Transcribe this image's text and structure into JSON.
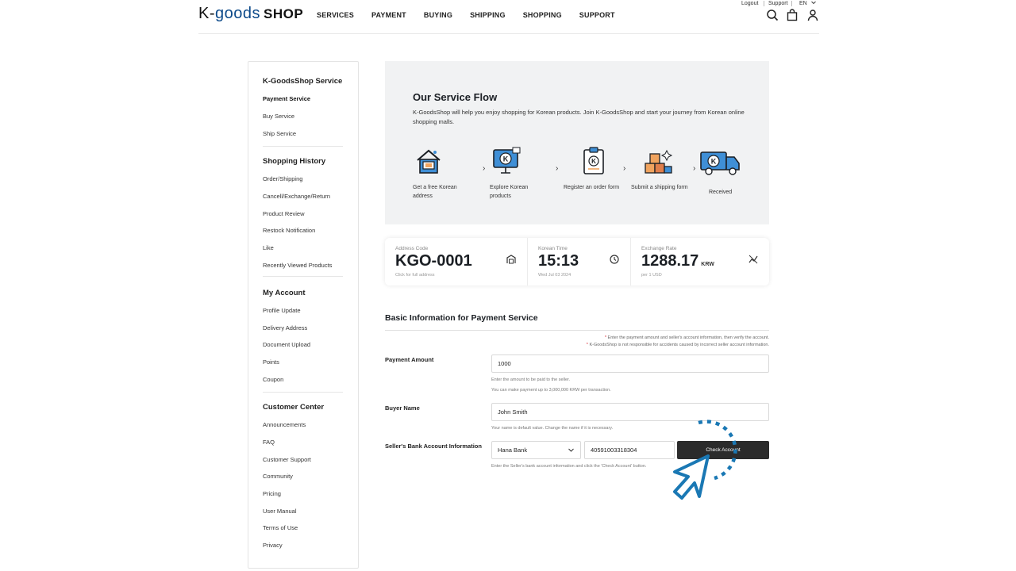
{
  "header": {
    "logo_part1": "K-",
    "logo_part2": "goods",
    "logo_part3": "SHOP",
    "nav": [
      "SERVICES",
      "PAYMENT",
      "BUYING",
      "SHIPPING",
      "SHOPPING",
      "SUPPORT"
    ],
    "util": {
      "logout": "Logout",
      "support": "Support",
      "lang": "EN"
    }
  },
  "sidebar": {
    "groups": [
      {
        "title": "K-GoodsShop Service",
        "items": [
          "Payment Service",
          "Buy Service",
          "Ship Service"
        ]
      },
      {
        "title": "Shopping History",
        "items": [
          "Order/Shipping",
          "Cancell/Exchange/Return",
          "Product Review",
          "Restock Notification",
          "Like",
          "Recently Viewed Products"
        ]
      },
      {
        "title": "My Account",
        "items": [
          "Profile Update",
          "Delivery Address",
          "Document Upload",
          "Points",
          "Coupon"
        ]
      },
      {
        "title": "Customer Center",
        "items": [
          "Announcements",
          "FAQ",
          "Customer Support",
          "Community",
          "Pricing",
          "User Manual",
          "Terms of Use",
          "Privacy"
        ]
      }
    ]
  },
  "flow": {
    "title": "Our Service Flow",
    "description": "K-GoodsShop will help you enjoy shopping for Korean products. Join K-GoodsShop and start your journey from Korean online shopping malls.",
    "steps": [
      {
        "label": "Get a free Korean address",
        "icon": "house-address-icon"
      },
      {
        "label": "Explore Korean products",
        "icon": "monitor-browse-icon"
      },
      {
        "label": "Register an order form",
        "icon": "clipboard-order-icon"
      },
      {
        "label": "Submit a shipping form",
        "icon": "stacked-boxes-icon"
      },
      {
        "label": "Received",
        "icon": "delivery-truck-icon"
      }
    ],
    "arrow": "›"
  },
  "info": {
    "address": {
      "label": "Address Code",
      "value": "KGO-0001",
      "sub": "Click for full address"
    },
    "time": {
      "label": "Korean Time",
      "value": "15:13",
      "sub": "Wed Jul 03 2024"
    },
    "rate": {
      "label": "Exchange Rate",
      "value": "1288.17",
      "unit": "KRW",
      "sub": "per 1 USD"
    }
  },
  "form": {
    "title": "Basic Information for Payment Service",
    "notice1": "Enter the payment amount and seller's account information, then verify the account.",
    "notice2": "K-GoodsShop is not responsible for accidents caused by incorrect seller account information.",
    "notice_star": "*",
    "payment_amount": {
      "label": "Payment Amount",
      "value": "1000",
      "help1": "Enter the amount to be paid to the seller.",
      "help2": "You can make payment up to 3,000,000 KRW per transaction."
    },
    "buyer_name": {
      "label": "Buyer Name",
      "value": "John Smith",
      "help": "Your name is default value. Change the name if it is necessary."
    },
    "bank": {
      "label": "Seller's Bank Account Information",
      "bank_value": "Hana Bank",
      "account_value": "40591003318304",
      "button": "Check Account",
      "help": "Enter the Seller's bank account information and click the 'Check Account' button."
    }
  },
  "colors": {
    "accent": "#0d4a8a",
    "cursor": "#1a78b4",
    "button": "#2b2b2b",
    "panel": "#f1f2f3"
  }
}
